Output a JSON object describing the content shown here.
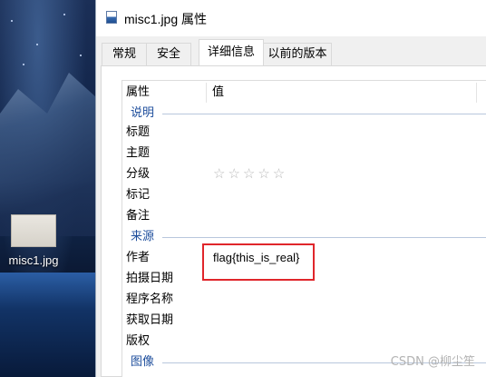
{
  "desktop": {
    "icon_label": "misc1.jpg"
  },
  "window": {
    "title": "misc1.jpg 属性",
    "tabs": [
      {
        "label": "常规",
        "active": false
      },
      {
        "label": "安全",
        "active": false
      },
      {
        "label": "详细信息",
        "active": true
      },
      {
        "label": "以前的版本",
        "active": false
      }
    ],
    "columns": {
      "property": "属性",
      "value": "值"
    },
    "groups": {
      "description": "说明",
      "origin": "来源",
      "image": "图像"
    },
    "description_rows": [
      {
        "key": "标题",
        "value": ""
      },
      {
        "key": "主题",
        "value": ""
      },
      {
        "key": "分级",
        "value": "☆☆☆☆☆"
      },
      {
        "key": "标记",
        "value": ""
      },
      {
        "key": "备注",
        "value": ""
      }
    ],
    "origin_rows": [
      {
        "key": "作者",
        "value": "flag{this_is_real}"
      },
      {
        "key": "拍摄日期",
        "value": ""
      },
      {
        "key": "程序名称",
        "value": ""
      },
      {
        "key": "获取日期",
        "value": ""
      },
      {
        "key": "版权",
        "value": ""
      }
    ],
    "rating_stars": 0
  },
  "watermark": "CSDN @柳尘笙",
  "colors": {
    "group_label": "#1e4e9c",
    "highlight_box": "#e0262b"
  }
}
